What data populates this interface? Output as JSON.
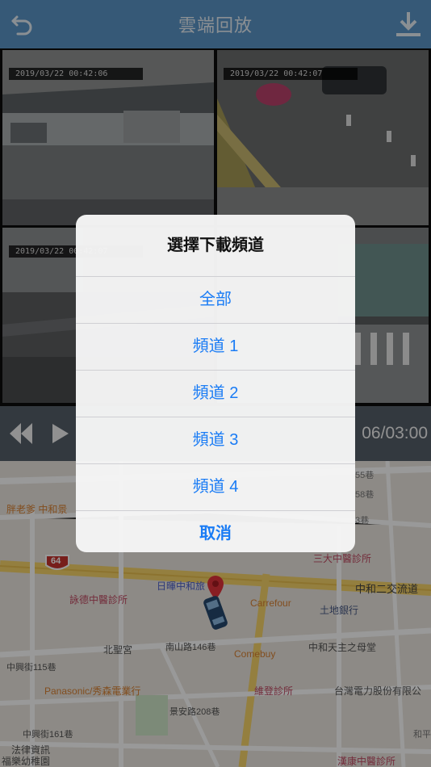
{
  "header": {
    "title": "雲端回放",
    "back_icon": "back-arrow-icon",
    "download_icon": "download-icon",
    "bg": "#5b95c7"
  },
  "videos": [
    {
      "timestamp": "2019/03/22 00:42:06"
    },
    {
      "timestamp": "2019/03/22 00:42:07"
    },
    {
      "timestamp": "2019/03/22 00:42:07"
    },
    {
      "timestamp": ""
    }
  ],
  "player": {
    "time": "06/03:00"
  },
  "map": {
    "highway_badge": "64",
    "labels": [
      "胖老爹 中和景",
      "詠德中醫診所",
      "日暉中和旅",
      "Carrefour",
      "三大中醫診所",
      "中和二交流道",
      "土地銀行",
      "北聖宮",
      "南山路146巷",
      "Comebuy",
      "中和天主之母堂",
      "中興街115巷",
      "Panasonic/秀森電業行",
      "維登診所",
      "台灣電力股份有限公",
      "中興街161巷",
      "景安路208巷",
      "法律資訊",
      "福樂幼稚園",
      "漢康中醫診所",
      "55巷",
      "58巷",
      "3巷",
      "和平"
    ]
  },
  "dialog": {
    "title": "選擇下載頻道",
    "options": [
      "全部",
      "頻道 1",
      "頻道 2",
      "頻道 3",
      "頻道 4"
    ],
    "cancel": "取消",
    "accent": "#1a7cf5"
  }
}
